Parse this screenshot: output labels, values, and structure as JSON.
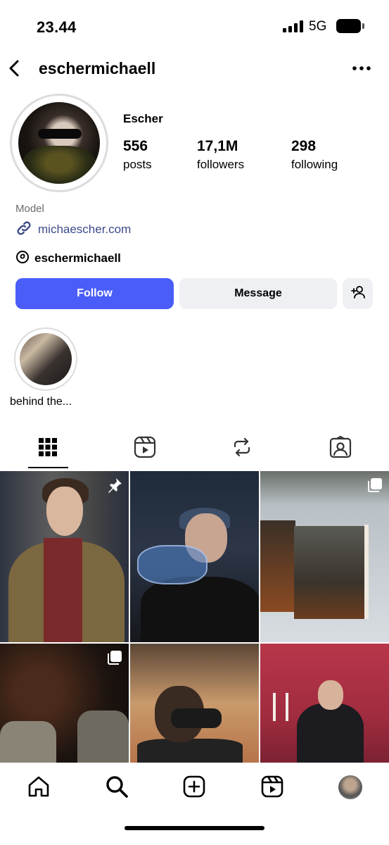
{
  "status_bar": {
    "time": "23.44",
    "network": "5G"
  },
  "header": {
    "username": "eschermichaell",
    "back_icon": "chevron-left-icon",
    "more_icon": "ellipsis-icon"
  },
  "profile": {
    "display_name": "Escher",
    "stats": [
      {
        "value": "556",
        "label": "posts"
      },
      {
        "value": "17,1M",
        "label": "followers"
      },
      {
        "value": "298",
        "label": "following"
      }
    ],
    "category": "Model",
    "link": "michaescher.com",
    "threads_handle": "eschermichaell"
  },
  "actions": {
    "follow": "Follow",
    "message": "Message",
    "accent_color": "#4a5df9"
  },
  "highlights": [
    {
      "label": "behind the..."
    }
  ],
  "tabs": [
    {
      "icon": "grid-icon",
      "active": true
    },
    {
      "icon": "reels-icon",
      "active": false
    },
    {
      "icon": "reposts-icon",
      "active": false
    },
    {
      "icon": "tagged-icon",
      "active": false
    }
  ],
  "grid": {
    "posts": [
      {
        "badge": "pin-icon"
      },
      {
        "badge": ""
      },
      {
        "badge": "carousel-icon"
      },
      {
        "badge": "carousel-icon"
      },
      {
        "badge": ""
      },
      {
        "badge": ""
      }
    ]
  },
  "bottom_nav": [
    {
      "icon": "home-icon"
    },
    {
      "icon": "search-icon"
    },
    {
      "icon": "create-icon"
    },
    {
      "icon": "reels-icon"
    },
    {
      "icon": "profile-avatar"
    }
  ]
}
